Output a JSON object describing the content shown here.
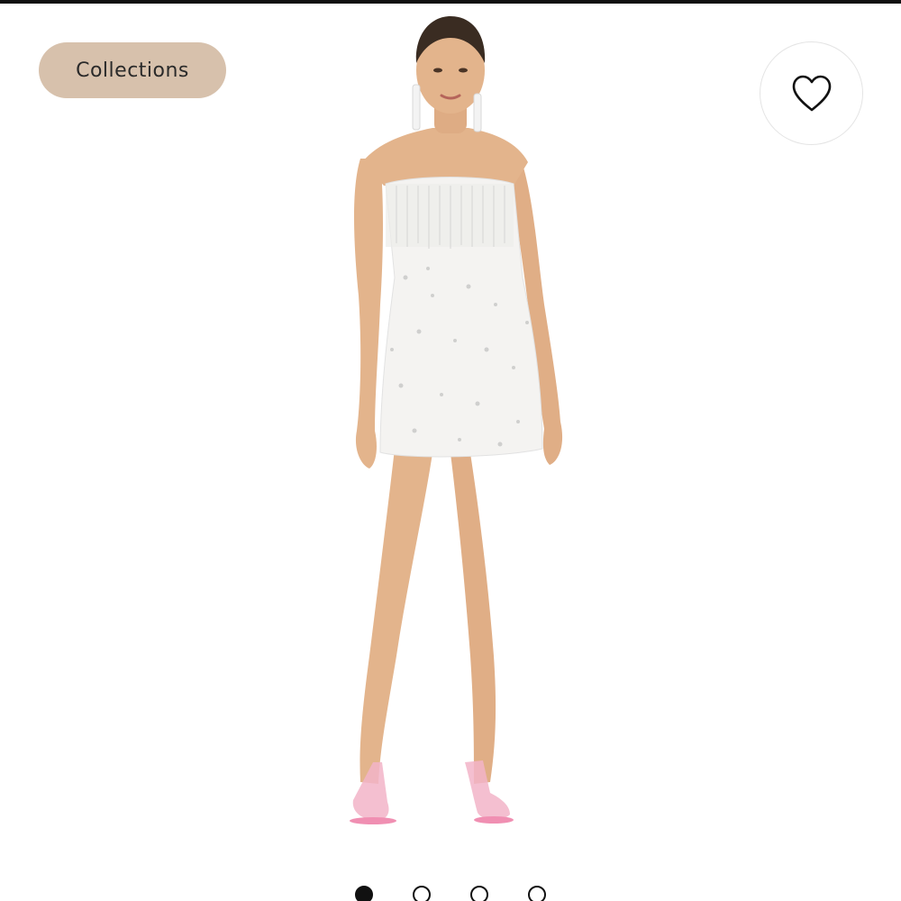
{
  "header": {
    "collections_label": "Collections",
    "favorite_icon": "heart-outline-icon"
  },
  "product": {
    "image_subject": "model-in-strapless-white-sequin-mini-dress",
    "dress_color": "#f4f3f1",
    "skin_tone": "#e3b48c",
    "shoe_color": "#f2b4c8"
  },
  "carousel": {
    "total_images": 4,
    "active_index": 0
  },
  "colors": {
    "collections_bg": "#d7c1ac",
    "top_bar": "#111111",
    "dot": "#111111"
  }
}
